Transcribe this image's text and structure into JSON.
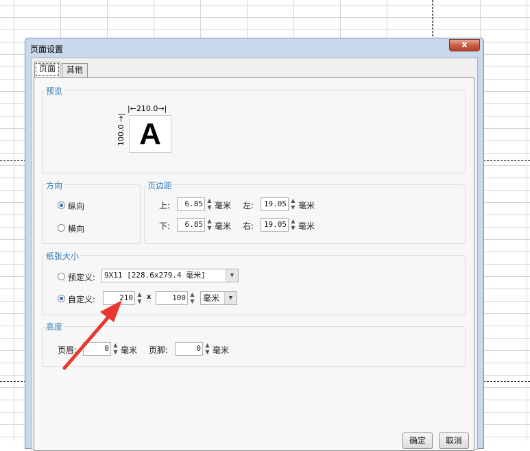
{
  "dialog": {
    "title": "页面设置",
    "close_label": "x",
    "tabs": [
      {
        "label": "页面"
      },
      {
        "label": "其他"
      }
    ],
    "preview": {
      "title": "预览",
      "width_label": "210.0",
      "height_label": "100.0",
      "sample_letter": "A"
    },
    "orientation": {
      "title": "方向",
      "portrait": "纵向",
      "landscape": "横向",
      "selected": "纵向"
    },
    "margins": {
      "title": "页边距",
      "top_label": "上:",
      "top_value": "6.85",
      "left_label": "左:",
      "left_value": "19.05",
      "bottom_label": "下:",
      "bottom_value": "6.85",
      "right_label": "右:",
      "right_value": "19.05",
      "unit": "毫米"
    },
    "paper_size": {
      "title": "纸张大小",
      "preset_label": "预定义:",
      "preset_value": "9X11 [228.6x279.4 毫米]",
      "custom_label": "自定义:",
      "width_value": "210",
      "times": "x",
      "height_value": "100",
      "unit_value": "毫米",
      "selected": "自定义"
    },
    "height_section": {
      "title": "高度",
      "header_label": "页眉:",
      "header_value": "0",
      "footer_label": "页脚:",
      "footer_value": "0",
      "unit": "毫米"
    },
    "buttons": {
      "ok": "确定",
      "cancel": "取消"
    }
  },
  "colors": {
    "accent_title": "#2a7ab6",
    "annotation_arrow": "#e8382e",
    "close_button": "#c75a3f"
  },
  "icons": {
    "spin_up": "▲",
    "spin_down": "▼",
    "dropdown": "▼"
  }
}
